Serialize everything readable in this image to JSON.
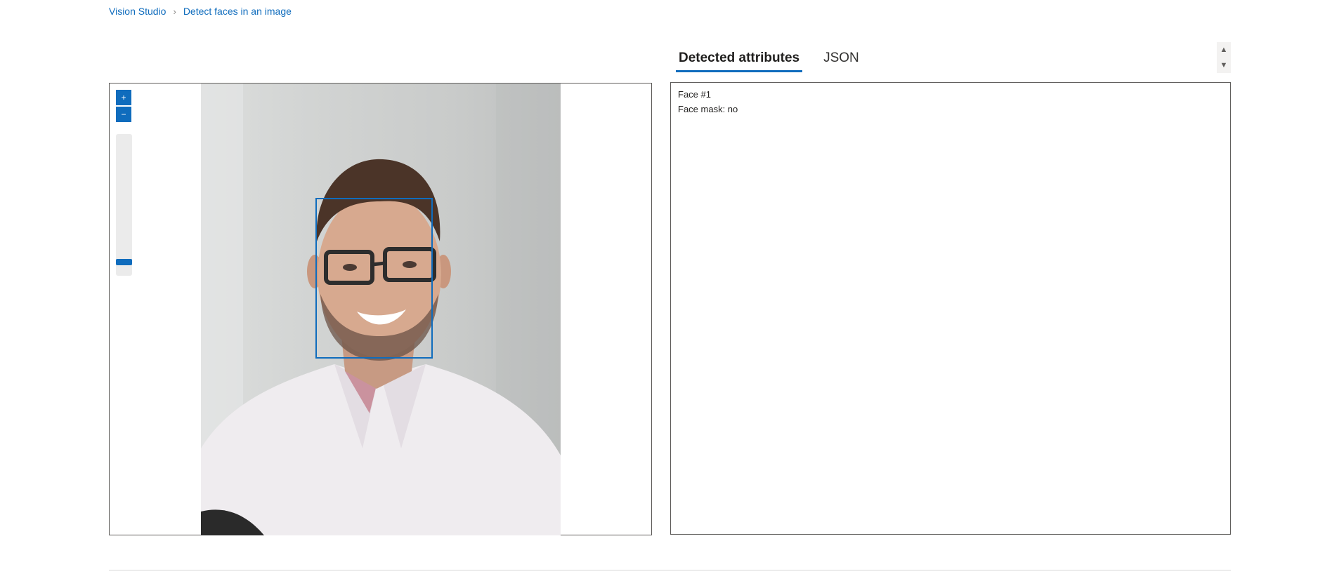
{
  "breadcrumb": {
    "home": "Vision Studio",
    "separator": "›",
    "current": "Detect faces in an image"
  },
  "viewer": {
    "zoom_in_icon": "+",
    "zoom_out_icon": "−",
    "zoom_level": 0.08,
    "detected_faces": 1
  },
  "tabs": [
    {
      "label": "Detected attributes",
      "active": true
    },
    {
      "label": "JSON",
      "active": false
    }
  ],
  "spinner": {
    "up_icon": "▲",
    "down_icon": "▼"
  },
  "results": {
    "face_label": "Face #1",
    "mask_label": "Face mask: no"
  },
  "colors": {
    "accent": "#0f6cbd",
    "border": "#605e5c"
  }
}
